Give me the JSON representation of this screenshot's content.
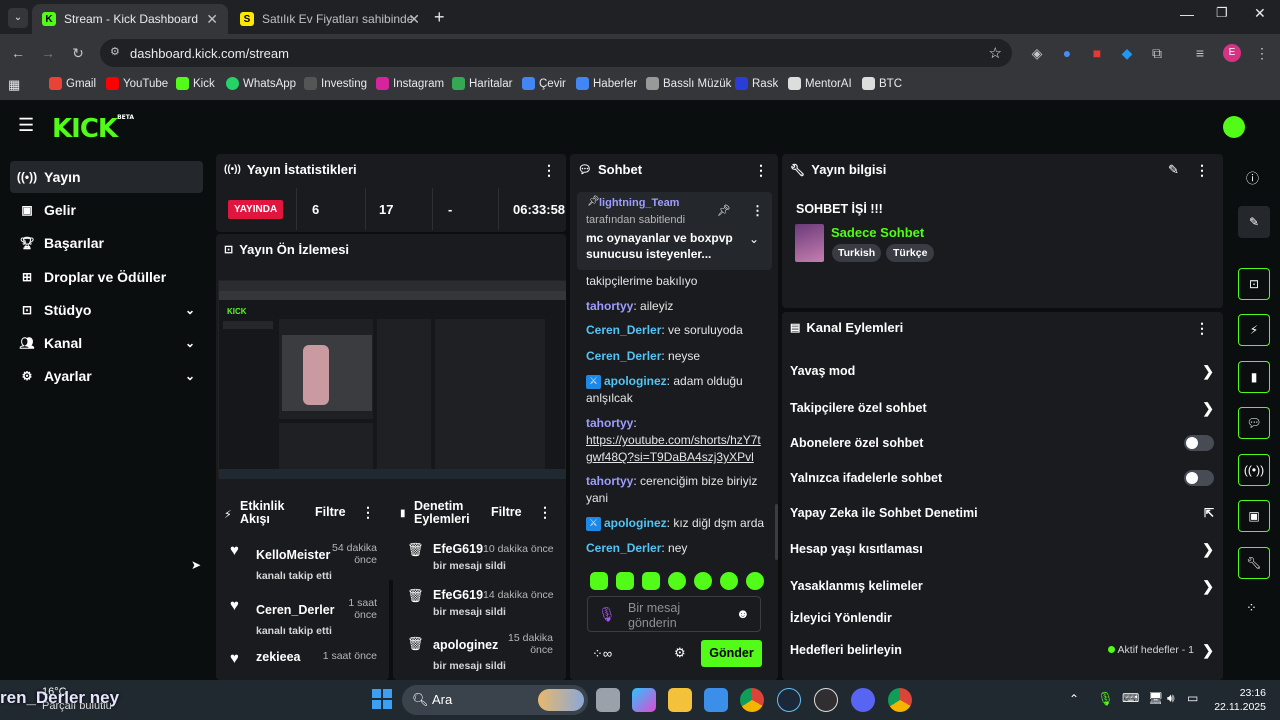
{
  "browser": {
    "tabs": [
      {
        "title": "Stream - Kick Dashboard",
        "favicon": "K",
        "active": true
      },
      {
        "title": "Satılık Ev Fiyatları sahibinden.co",
        "favicon": "S",
        "active": false
      }
    ],
    "url": "dashboard.kick.com/stream",
    "profile_initial": "E",
    "bookmarks": [
      "Gmail",
      "YouTube",
      "Kick",
      "WhatsApp",
      "Investing",
      "Instagram",
      "Haritalar",
      "Çevir",
      "Haberler",
      "Basslı Müzük",
      "Rask",
      "MentorAI",
      "BTC"
    ]
  },
  "kick": {
    "logo": "KICK",
    "logo_badge": "BETA",
    "nav": [
      {
        "label": "Yayın",
        "icon": "broadcast-icon",
        "active": true,
        "expand": false
      },
      {
        "label": "Gelir",
        "icon": "revenue-icon",
        "active": false,
        "expand": false
      },
      {
        "label": "Başarılar",
        "icon": "trophy-icon",
        "active": false,
        "expand": false
      },
      {
        "label": "Droplar ve Ödüller",
        "icon": "gift-icon",
        "active": false,
        "expand": false
      },
      {
        "label": "Stüdyo",
        "icon": "studio-icon",
        "active": false,
        "expand": true
      },
      {
        "label": "Kanal",
        "icon": "channel-icon",
        "active": false,
        "expand": true
      },
      {
        "label": "Ayarlar",
        "icon": "settings-icon",
        "active": false,
        "expand": true
      }
    ],
    "stats": {
      "title": "Yayın İstatistikleri",
      "live_label": "YAYINDA",
      "values": [
        "6",
        "17",
        "-",
        "06:33:58"
      ]
    },
    "preview": {
      "title": "Yayın Ön İzlemesi"
    },
    "activity": {
      "title_line1": "Etkinlik",
      "title_line2": "Akışı",
      "filter": "Filtre",
      "items": [
        {
          "name": "KelloMeister",
          "time_line1": "54 dakika",
          "time_line2": "önce",
          "action": "kanalı takip etti"
        },
        {
          "name": "Ceren_Derler",
          "time_line1": "1 saat",
          "time_line2": "önce",
          "action": "kanalı takip etti"
        },
        {
          "name": "zekieea",
          "time_line1": "1 saat önce",
          "time_line2": "",
          "action": ""
        }
      ]
    },
    "moderation": {
      "title_line1": "Denetim",
      "title_line2": "Eylemleri",
      "filter": "Filtre",
      "items": [
        {
          "name": "EfeG619",
          "time": "10 dakika önce",
          "action": "bir mesajı sildi"
        },
        {
          "name": "EfeG619",
          "time": "14 dakika önce",
          "action": "bir mesajı sildi"
        },
        {
          "name": "apologinez",
          "time_line1": "15 dakika",
          "time_line2": "önce",
          "action": "bir mesajı sildi"
        }
      ]
    },
    "chat": {
      "title": "Sohbet",
      "pinned_user": "lightning_Team",
      "pinned_by": "tarafından sabitlendi",
      "pinned_message": "mc oynayanlar ve boxpvp sunucusu isteyenler...",
      "messages": [
        {
          "user": "",
          "text": "takipçilerime bakılıyo"
        },
        {
          "user": "tahortyy",
          "text": "aileyiz"
        },
        {
          "user": "Ceren_Derler",
          "text": "ve soruluyoda"
        },
        {
          "user": "Ceren_Derler",
          "text": "neyse"
        },
        {
          "user": "apologinez",
          "text": "adam olduğu anlşılcak"
        },
        {
          "user": "tahortyy",
          "text": "https://youtube.com/shorts/hzY7tgwf48Q?si=T9DaBA4szj3yXPvl"
        },
        {
          "user": "tahortyy",
          "text": "cerenciğim bize biriyiz yani"
        },
        {
          "user": "apologinez",
          "text": "kız diğl dşm arda"
        },
        {
          "user": "Ceren_Derler",
          "text": "ney"
        }
      ],
      "input_placeholder": "Bir mesaj gönderin",
      "send_label": "Gönder"
    },
    "stream_info": {
      "title": "Yayın bilgisi",
      "stream_title": "SOHBET İŞİ !!!",
      "category": "Sadece Sohbet",
      "tags": [
        "Turkish",
        "Türkçe"
      ]
    },
    "channel_actions": {
      "title": "Kanal Eylemleri",
      "rows": [
        {
          "label": "Yavaş mod",
          "control": "chevron"
        },
        {
          "label": "Takipçilere özel sohbet",
          "control": "chevron"
        },
        {
          "label": "Abonelere özel sohbet",
          "control": "toggle"
        },
        {
          "label": "Yalnızca ifadelerle sohbet",
          "control": "toggle"
        },
        {
          "label": "Yapay Zeka ile Sohbet Denetimi",
          "control": "external"
        },
        {
          "label": "Hesap yaşı kısıtlaması",
          "control": "chevron"
        },
        {
          "label": "Yasaklanmış kelimeler",
          "control": "chevron"
        },
        {
          "label": "İzleyici Yönlendir",
          "control": "none"
        },
        {
          "label": "Hedefleri belirleyin",
          "control": "chevron"
        }
      ],
      "goals_status": "Aktif hedefler - 1"
    }
  },
  "taskbar": {
    "weather_temp": "16°C",
    "weather_desc": "Parçalı bulutlu",
    "overlay_text": "ren_Derler ney",
    "search": "Ara",
    "time": "23:16",
    "date": "22.11.2025"
  },
  "colors": {
    "kick_green": "#53fc18",
    "live_red": "#e0163f",
    "panel": "#191b1f",
    "bg": "#0b0e0f"
  }
}
